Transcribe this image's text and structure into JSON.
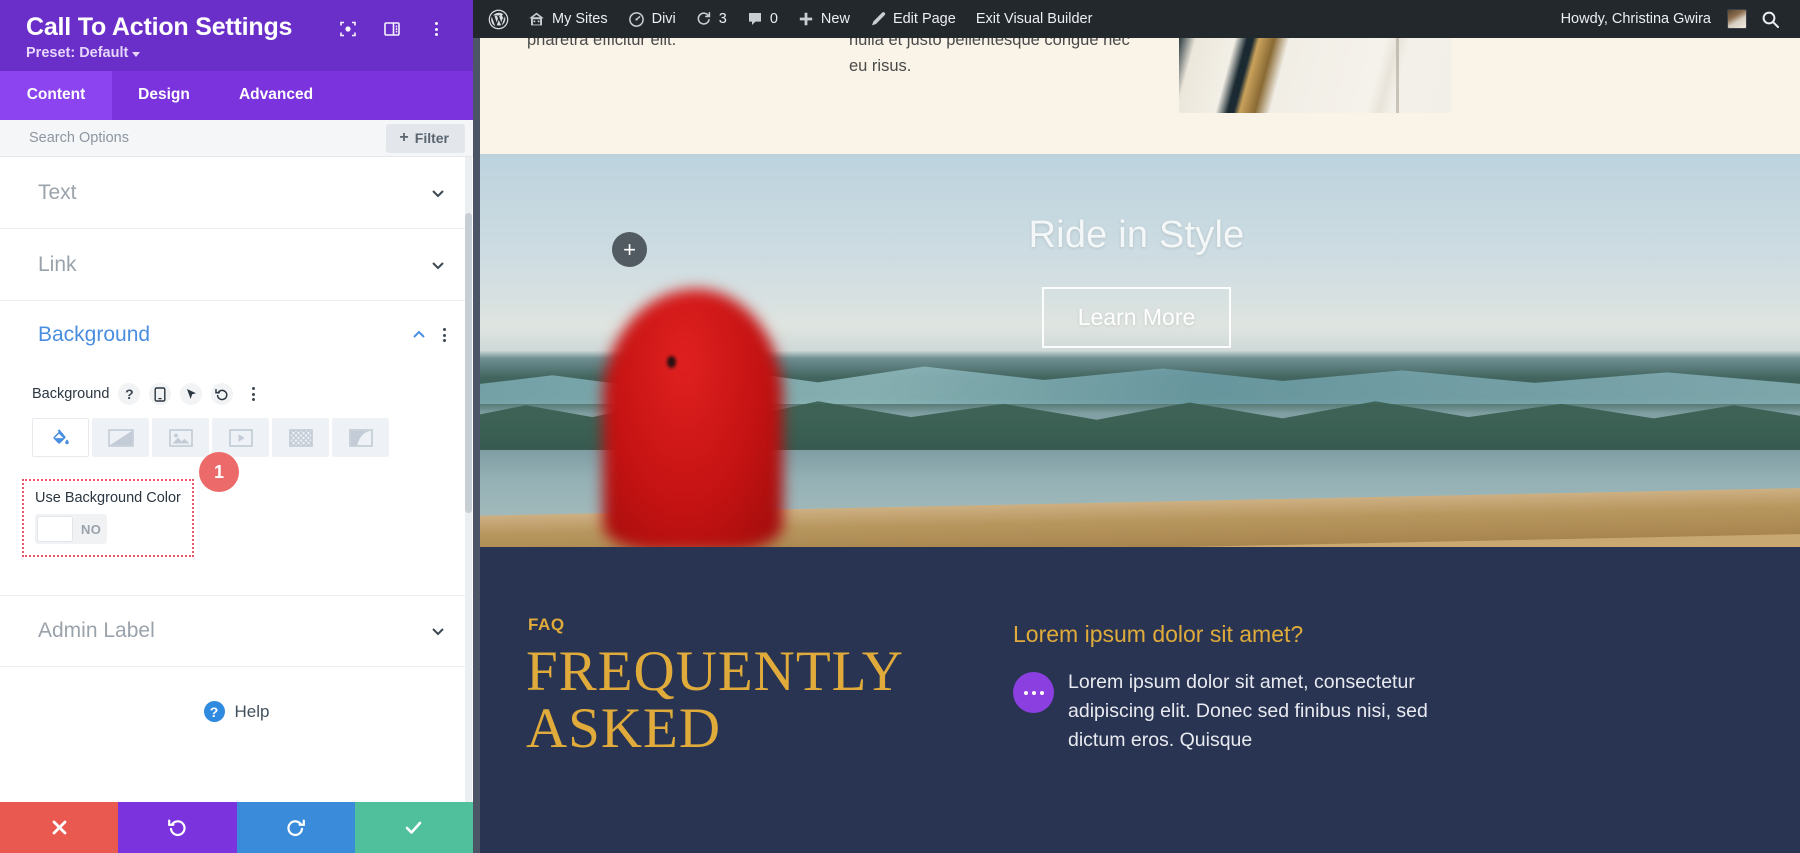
{
  "settings_panel": {
    "title": "Call To Action Settings",
    "preset_label": "Preset: Default",
    "header_icons": [
      {
        "name": "focus-target-icon"
      },
      {
        "name": "layout-columns-icon"
      },
      {
        "name": "kebab-menu-icon"
      }
    ],
    "tabs": [
      {
        "label": "Content",
        "active": true
      },
      {
        "label": "Design",
        "active": false
      },
      {
        "label": "Advanced",
        "active": false
      }
    ],
    "search": {
      "placeholder": "Search Options",
      "value": "",
      "filter_label": "Filter",
      "filter_plus": "+"
    },
    "sections": [
      {
        "label": "Text",
        "open": false
      },
      {
        "label": "Link",
        "open": false
      },
      {
        "label": "Background",
        "open": true
      },
      {
        "label": "Admin Label",
        "open": false
      }
    ],
    "background_section": {
      "title": "Background",
      "field_label": "Background",
      "field_icons": [
        {
          "name": "help-icon",
          "glyph": "?"
        },
        {
          "name": "responsive-phone-icon",
          "glyph": ""
        },
        {
          "name": "hover-cursor-icon",
          "glyph": ""
        },
        {
          "name": "reset-undo-icon",
          "glyph": ""
        },
        {
          "name": "kebab-menu-icon",
          "glyph": ""
        }
      ],
      "types": [
        {
          "name": "background-color-tab",
          "selected": true
        },
        {
          "name": "background-gradient-tab",
          "selected": false
        },
        {
          "name": "background-image-tab",
          "selected": false
        },
        {
          "name": "background-video-tab",
          "selected": false
        },
        {
          "name": "background-pattern-tab",
          "selected": false
        },
        {
          "name": "background-mask-tab",
          "selected": false
        }
      ],
      "toggle": {
        "label": "Use Background Color",
        "value": "NO"
      },
      "annotation_badge": "1"
    },
    "help_label": "Help",
    "footer_buttons": [
      {
        "name": "cancel-button",
        "glyph": "✖",
        "color": "#e9594f"
      },
      {
        "name": "undo-button",
        "glyph": "↺",
        "color": "#7b33de"
      },
      {
        "name": "redo-button",
        "glyph": "↻",
        "color": "#3a8cdb"
      },
      {
        "name": "save-button",
        "glyph": "✔",
        "color": "#4fc09b"
      }
    ]
  },
  "admin_bar": {
    "items": [
      {
        "name": "wordpress-logo-icon",
        "label": ""
      },
      {
        "name": "my-sites-menu",
        "label": "My Sites"
      },
      {
        "name": "divi-menu",
        "label": "Divi"
      },
      {
        "name": "updates-count",
        "label": "3"
      },
      {
        "name": "comments-count",
        "label": "0"
      },
      {
        "name": "new-content-menu",
        "label": "New"
      },
      {
        "name": "edit-page-link",
        "label": "Edit Page"
      },
      {
        "name": "exit-visual-builder-link",
        "label": "Exit Visual Builder"
      }
    ],
    "howdy": "Howdy, Christina Gwira",
    "search_icon": "search-icon"
  },
  "page": {
    "top_section": {
      "column1_text": "pharetra efficitur elit.",
      "column2_text": "nulla et justo pellentesque congue nec eu risus."
    },
    "hero": {
      "title": "Ride in Style",
      "button_label": "Learn More",
      "add_module_glyph": "+"
    },
    "faq": {
      "kicker": "FAQ",
      "heading_line1": "FREQUENTLY",
      "heading_line2": "ASKED",
      "question": "Lorem ipsum dolor sit amet?",
      "answer": "Lorem ipsum dolor sit amet, consectetur adipiscing elit. Donec sed finibus nisi, sed dictum eros. Quisque"
    }
  },
  "colors": {
    "panel_header": "#6b2fc9",
    "panel_tabs": "#7b33de",
    "accent_blue": "#4a8ee0",
    "annotation_red": "#e8546a",
    "faq_gold": "#e0ab3a",
    "faq_bg": "#283452"
  }
}
